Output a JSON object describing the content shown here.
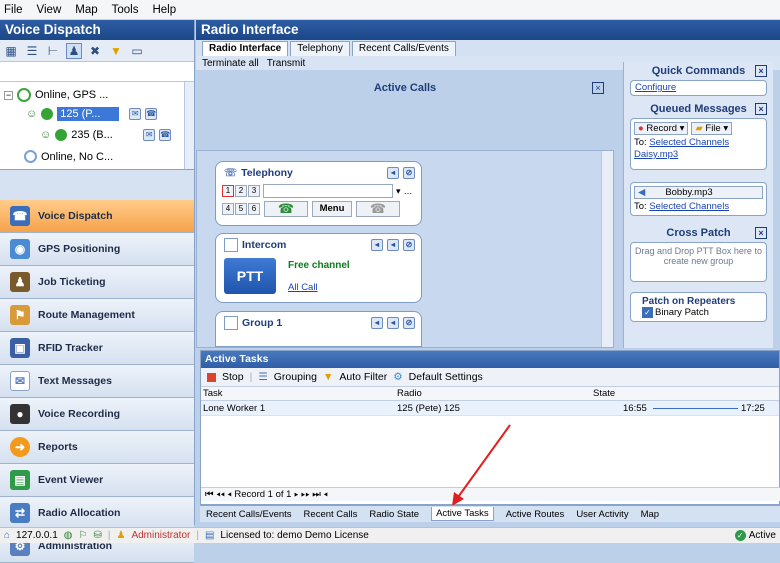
{
  "menu": [
    "File",
    "View",
    "Map",
    "Tools",
    "Help"
  ],
  "left": {
    "title": "Voice Dispatch",
    "tree": [
      {
        "label": "Online, GPS ..."
      },
      {
        "label": "125 (P..."
      },
      {
        "label": "235 (B..."
      },
      {
        "label": "Online, No C..."
      }
    ],
    "nav": [
      {
        "label": "Voice Dispatch"
      },
      {
        "label": "GPS Positioning"
      },
      {
        "label": "Job Ticketing"
      },
      {
        "label": "Route Management"
      },
      {
        "label": "RFID Tracker"
      },
      {
        "label": "Text Messages"
      },
      {
        "label": "Voice Recording"
      },
      {
        "label": "Reports"
      },
      {
        "label": "Event Viewer"
      },
      {
        "label": "Radio Allocation"
      },
      {
        "label": "Administration"
      }
    ]
  },
  "main": {
    "title": "Radio Interface",
    "tabs": [
      "Radio Interface",
      "Telephony",
      "Recent Calls/Events"
    ],
    "actions": {
      "terminate": "Terminate all",
      "transmit": "Transmit"
    },
    "active_calls": "Active Calls",
    "telephony": {
      "title": "Telephony",
      "keys": [
        "1",
        "2",
        "3",
        "4",
        "5",
        "6"
      ],
      "menu": "Menu"
    },
    "intercom": {
      "title": "Intercom",
      "status": "Free channel",
      "ptt": "PTT",
      "link": "All Call"
    },
    "group1": {
      "title": "Group 1"
    }
  },
  "right": {
    "quick_commands": "Quick Commands",
    "configure": "Configure",
    "queued_messages": "Queued Messages",
    "record": "Record",
    "file": "File",
    "to_label": "To:",
    "selected_channels": "Selected Channels",
    "daisy": "Daisy.mp3",
    "bobby": "Bobby.mp3",
    "cross_patch": "Cross Patch",
    "drag_hint": "Drag and Drop PTT Box here to create new group",
    "patch_repeaters": "Patch on Repeaters",
    "binary_patch": "Binary Patch"
  },
  "tasks": {
    "title": "Active Tasks",
    "toolbar": {
      "stop": "Stop",
      "grouping": "Grouping",
      "autofilter": "Auto Filter",
      "defaults": "Default Settings"
    },
    "columns": [
      "Task",
      "Radio",
      "State"
    ],
    "row": {
      "task": "Lone Worker 1",
      "radio": "125 (Pete) 125",
      "start": "16:55",
      "end": "17:25"
    },
    "pager": "Record 1 of 1"
  },
  "bottom_tabs": [
    "Recent Calls/Events",
    "Recent Calls",
    "Radio State",
    "Active Tasks",
    "Active Routes",
    "User Activity",
    "Map"
  ],
  "status": {
    "ip": "127.0.0.1",
    "user": "Administrator",
    "license": "Licensed to: demo Demo License",
    "right": "Active"
  }
}
